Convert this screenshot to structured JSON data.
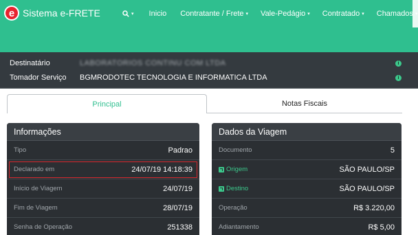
{
  "app": {
    "logo_letter": "e",
    "title": "Sistema e-FRETE"
  },
  "nav": {
    "search_icon": "🔍",
    "items": [
      {
        "label": "Inicio",
        "has_caret": false
      },
      {
        "label": "Contratante / Frete",
        "has_caret": true
      },
      {
        "label": "Vale-Pedágio",
        "has_caret": true
      },
      {
        "label": "Contratado",
        "has_caret": true
      },
      {
        "label": "Chamados",
        "has_caret": true
      }
    ],
    "caret": "▾"
  },
  "strip": {
    "destinatario_label": "Destinatário",
    "destinatario_value": "LABORATORIOS CONTINU COM LTDA",
    "tomador_label": "Tomador Serviço",
    "tomador_value": "BGMRODOTEC TECNOLOGIA E INFORMATICA LTDA",
    "info_glyph": "i"
  },
  "tabs": {
    "principal": "Principal",
    "notas": "Notas Fiscais"
  },
  "informacoes": {
    "title": "Informações",
    "rows": [
      {
        "label": "Tipo",
        "value": "Padrao"
      },
      {
        "label": "Declarado em",
        "value": "24/07/19 14:18:39"
      },
      {
        "label": "Início de Viagem",
        "value": "24/07/19"
      },
      {
        "label": "Fim de Viagem",
        "value": "28/07/19"
      },
      {
        "label": "Senha de Operação",
        "value": "251338"
      }
    ]
  },
  "dados_viagem": {
    "title": "Dados da Viagem",
    "rows": [
      {
        "label": "Documento",
        "value": "5"
      },
      {
        "label": "Origem",
        "value": "SÃO PAULO/SP"
      },
      {
        "label": "Destino",
        "value": "SÃO PAULO/SP"
      },
      {
        "label": "Operação",
        "value": "R$ 3.220,00"
      },
      {
        "label": "Adiantamento",
        "value": "R$ 5,00"
      }
    ]
  },
  "colors": {
    "navbar": "#2fbf8f",
    "accent": "#3cc98c",
    "panel": "#2b2f33",
    "highlight": "#d9282e"
  }
}
